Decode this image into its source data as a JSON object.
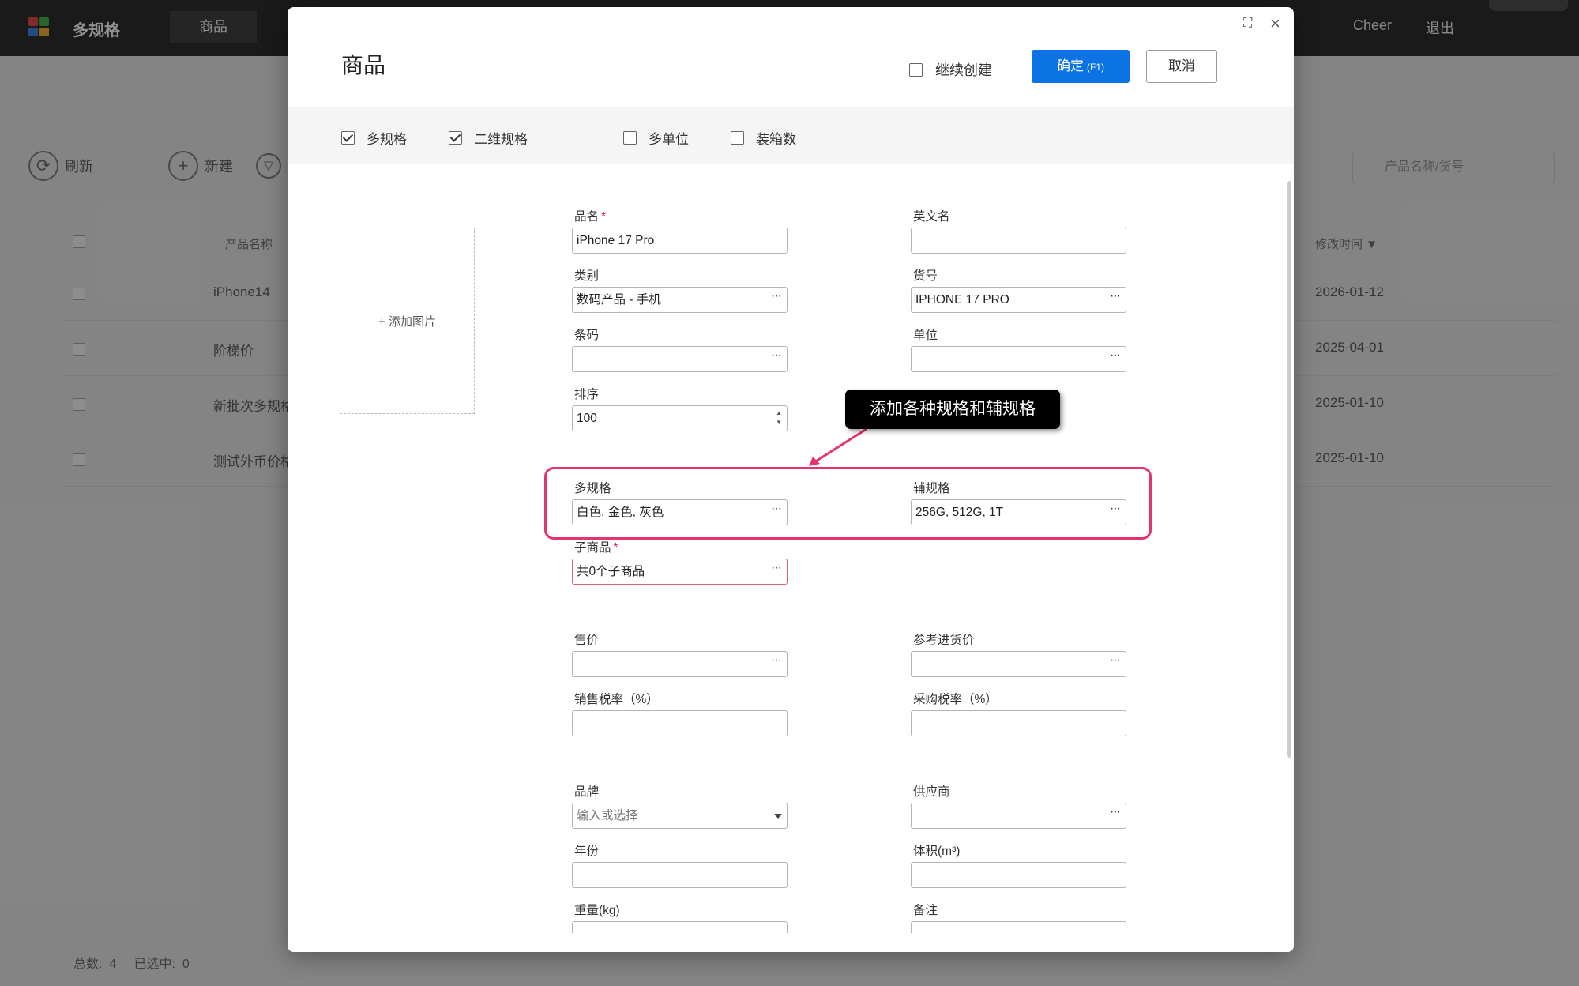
{
  "app": {
    "title": "多规格",
    "active_tab": "商品",
    "user": "Cheer",
    "logout": "退出"
  },
  "background": {
    "refresh": "刷新",
    "new": "新建",
    "search_placeholder": "产品名称/货号",
    "col_name": "产品名称",
    "col_modified": "修改时间",
    "rows": [
      {
        "name": "iPhone14",
        "date": "2026-01-12"
      },
      {
        "name": "阶梯价",
        "date": "2025-04-01"
      },
      {
        "name": "新批次多规格",
        "date": "2025-01-10"
      },
      {
        "name": "测试外币价格",
        "date": "2025-01-10"
      }
    ],
    "footer_total_label": "总数:",
    "footer_total": "4",
    "footer_selected_label": "已选中:",
    "footer_selected": "0"
  },
  "dialog": {
    "title": "商品",
    "continue_create": "继续创建",
    "ok": "确定",
    "ok_shortcut": "(F1)",
    "cancel": "取消",
    "options": [
      {
        "label": "多规格",
        "checked": true
      },
      {
        "label": "二维规格",
        "checked": true
      },
      {
        "label": "多单位",
        "checked": false
      },
      {
        "label": "装箱数",
        "checked": false
      }
    ],
    "add_image": "+ 添加图片",
    "fields": {
      "name": {
        "label": "品名",
        "value": "iPhone 17 Pro"
      },
      "english_name": {
        "label": "英文名",
        "value": ""
      },
      "category": {
        "label": "类别",
        "value": "数码产品 - 手机"
      },
      "sku": {
        "label": "货号",
        "value": "IPHONE 17 PRO"
      },
      "barcode": {
        "label": "条码",
        "value": ""
      },
      "unit": {
        "label": "单位",
        "value": ""
      },
      "sort": {
        "label": "排序",
        "value": "100"
      },
      "multi_spec": {
        "label": "多规格",
        "value": "白色, 金色, 灰色"
      },
      "aux_spec": {
        "label": "辅规格",
        "value": "256G, 512G, 1T"
      },
      "sub_products": {
        "label": "子商品",
        "value": "共0个子商品"
      },
      "price": {
        "label": "售价",
        "value": ""
      },
      "ref_purchase_price": {
        "label": "参考进货价",
        "value": ""
      },
      "sales_tax": {
        "label": "销售税率（%）",
        "value": ""
      },
      "purchase_tax": {
        "label": "采购税率（%）",
        "value": ""
      },
      "brand": {
        "label": "品牌",
        "placeholder": "输入或选择"
      },
      "supplier": {
        "label": "供应商",
        "value": ""
      },
      "year": {
        "label": "年份",
        "value": ""
      },
      "volume": {
        "label": "体积(m³)",
        "value": ""
      },
      "weight": {
        "label": "重量(kg)",
        "value": ""
      },
      "remark": {
        "label": "备注",
        "value": ""
      }
    },
    "required_mark": "*"
  },
  "annotation": {
    "text": "添加各种规格和辅规格",
    "color": "#e5336f"
  },
  "colors": {
    "primary": "#0b73e4",
    "accent": "#e5336f"
  }
}
